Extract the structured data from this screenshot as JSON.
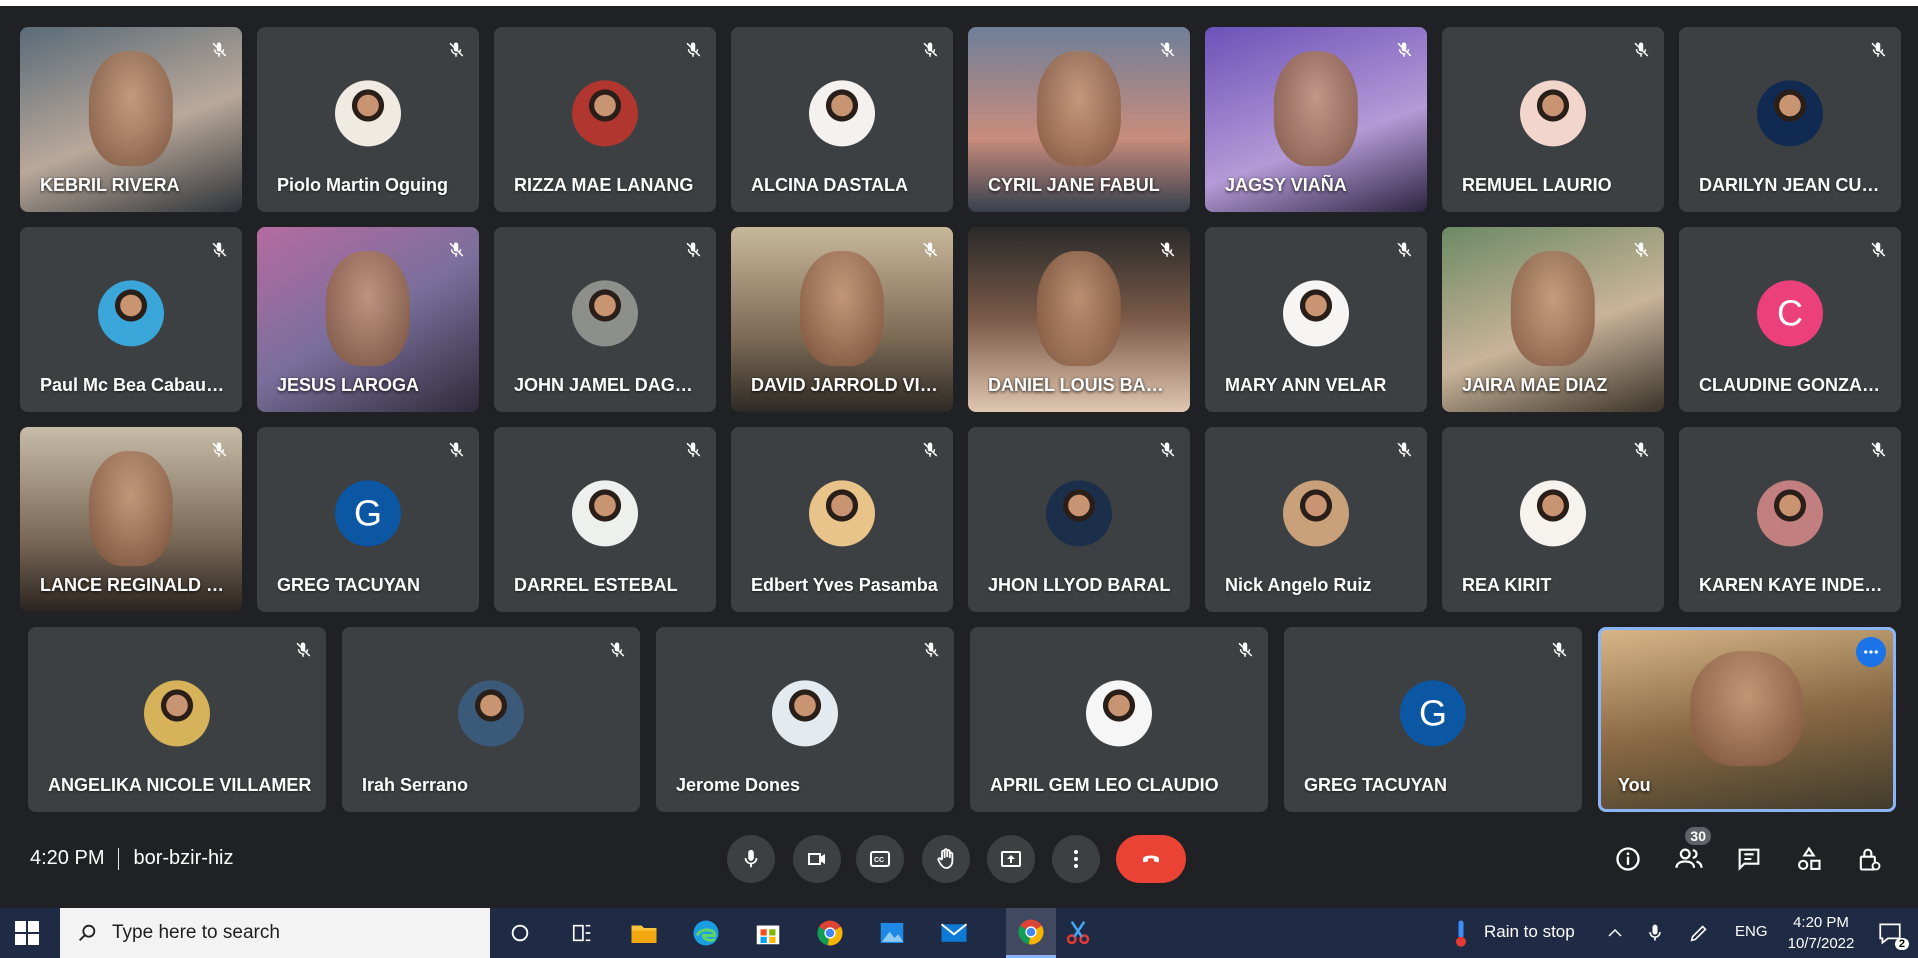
{
  "meeting": {
    "time": "4:20 PM",
    "code": "bor-bzir-hiz",
    "participants_count": "30"
  },
  "participants": [
    {
      "name": "KEBRIL RIVERA",
      "type": "video"
    },
    {
      "name": "Piolo Martin Oguing",
      "type": "photo"
    },
    {
      "name": "RIZZA MAE LANANG",
      "type": "photo"
    },
    {
      "name": "ALCINA DASTALA",
      "type": "photo"
    },
    {
      "name": "CYRIL JANE FABUL",
      "type": "video"
    },
    {
      "name": "JAGSY VIAÑA",
      "type": "video"
    },
    {
      "name": "REMUEL LAURIO",
      "type": "photo"
    },
    {
      "name": "DARILYN JEAN CUM...",
      "type": "photo"
    },
    {
      "name": "Paul Mc Bea Cabaua...",
      "type": "photo"
    },
    {
      "name": "JESUS LAROGA",
      "type": "video"
    },
    {
      "name": "JOHN JAMEL DAGO...",
      "type": "photo"
    },
    {
      "name": "DAVID JARROLD VIL...",
      "type": "video"
    },
    {
      "name": "DANIEL LOUIS BARB...",
      "type": "video"
    },
    {
      "name": "MARY ANN VELAR",
      "type": "photo"
    },
    {
      "name": "JAIRA MAE DIAZ",
      "type": "video"
    },
    {
      "name": "CLAUDINE GONZAL...",
      "type": "letter",
      "letter": "C",
      "color": "#ec407a"
    },
    {
      "name": "LANCE REGINALD C...",
      "type": "video"
    },
    {
      "name": "GREG TACUYAN",
      "type": "letter",
      "letter": "G",
      "color": "#0b57a4"
    },
    {
      "name": "DARREL ESTEBAL",
      "type": "photo"
    },
    {
      "name": "Edbert Yves Pasamba",
      "type": "photo"
    },
    {
      "name": "JHON LLYOD BARAL",
      "type": "photo"
    },
    {
      "name": "Nick Angelo Ruiz",
      "type": "photo"
    },
    {
      "name": "REA KIRIT",
      "type": "photo"
    },
    {
      "name": "KAREN KAYE INDEN...",
      "type": "photo"
    },
    {
      "name": "ANGELIKA NICOLE VILLAMER",
      "type": "photo"
    },
    {
      "name": "Irah Serrano",
      "type": "photo"
    },
    {
      "name": "Jerome Dones",
      "type": "photo"
    },
    {
      "name": "APRIL GEM LEO CLAUDIO",
      "type": "photo"
    },
    {
      "name": "GREG TACUYAN",
      "type": "letter",
      "letter": "G",
      "color": "#0b57a4"
    },
    {
      "name": "You",
      "type": "self"
    }
  ],
  "controls": [
    "mic-icon",
    "camera-icon",
    "captions-icon",
    "raise-hand-icon",
    "present-icon",
    "more-options-icon",
    "end-call-icon"
  ],
  "right_controls": [
    "info-icon",
    "people-icon",
    "chat-icon",
    "activities-icon",
    "host-controls-icon"
  ],
  "taskbar": {
    "search_placeholder": "Type here to search",
    "weather": "Rain to stop",
    "lang": "ENG",
    "time": "4:20 PM",
    "date": "10/7/2022",
    "notifications": "2"
  }
}
